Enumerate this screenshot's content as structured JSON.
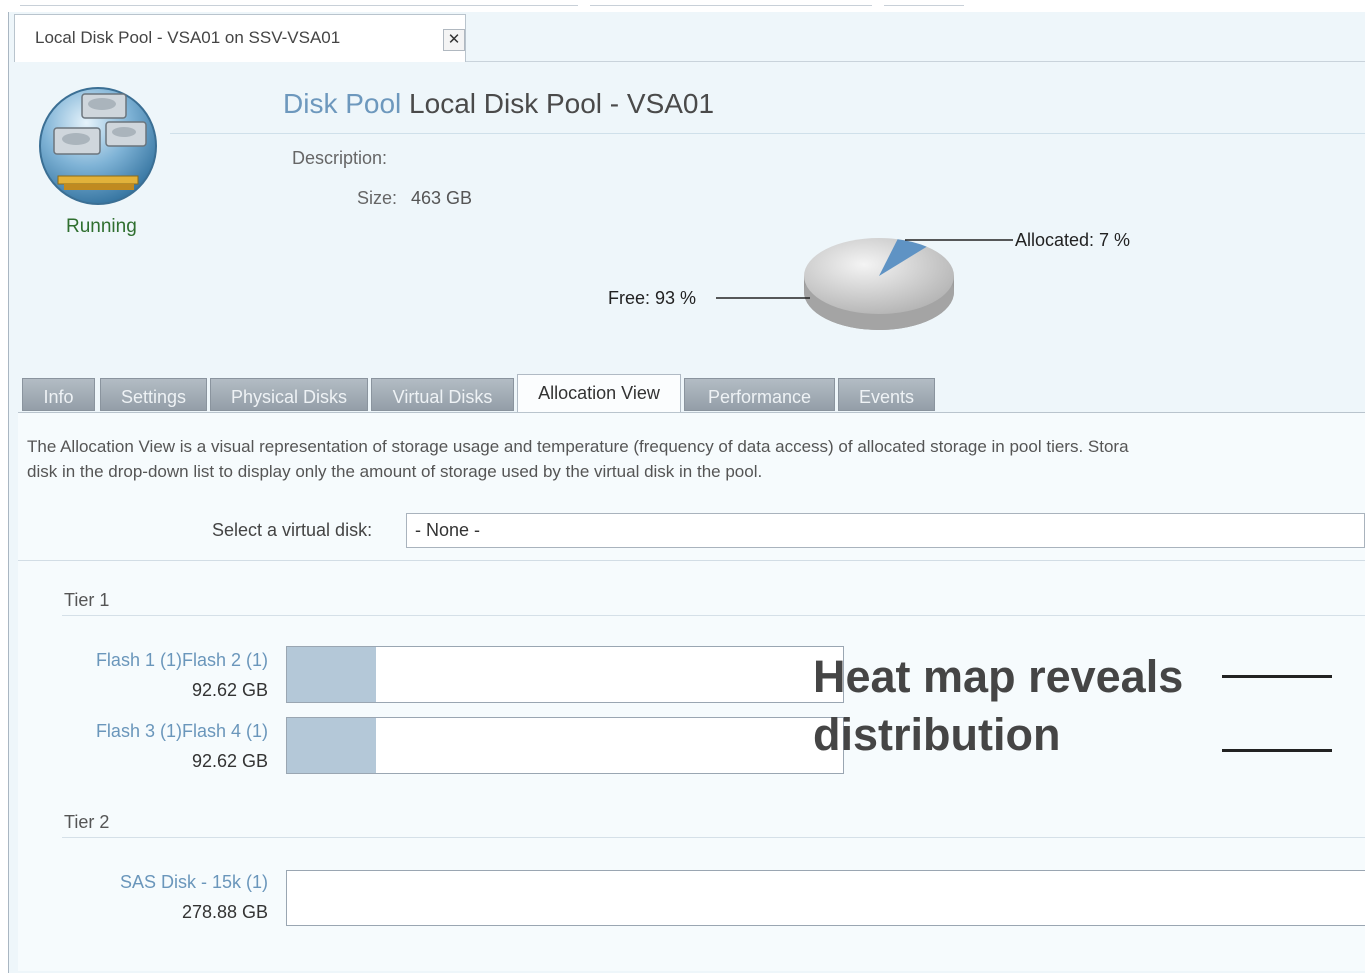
{
  "document_tab": {
    "label": "Local Disk Pool - VSA01 on SSV-VSA01",
    "close_symbol": "✕"
  },
  "pool": {
    "status": "Running",
    "type_label": "Disk Pool",
    "name": "Local Disk Pool - VSA01",
    "description_label": "Description:",
    "size_label": "Size:",
    "size_value": "463 GB"
  },
  "pie_chart": {
    "allocated_label": "Allocated: 7 %",
    "free_label": "Free: 93 %",
    "allocated_percent": 7,
    "free_percent": 93
  },
  "tabs": [
    {
      "label": "Info"
    },
    {
      "label": "Settings"
    },
    {
      "label": "Physical Disks"
    },
    {
      "label": "Virtual Disks"
    },
    {
      "label": "Allocation View"
    },
    {
      "label": "Performance"
    },
    {
      "label": "Events"
    }
  ],
  "active_tab": "Allocation View",
  "allocation_view": {
    "intro_line1": "The Allocation View is a visual representation of storage usage and temperature (frequency of data access) of allocated storage in pool tiers. Stora",
    "intro_line2": "disk in the drop-down list to display only the amount of storage used by the virtual disk in the pool.",
    "select_label": "Select a virtual disk:",
    "select_value": "- None -",
    "tiers": [
      {
        "name": "Tier 1",
        "disks": [
          {
            "name": "Flash 1 (1)Flash 2 (1)",
            "size": "92.62 GB",
            "heat_fraction": 0.16
          },
          {
            "name": "Flash 3 (1)Flash 4 (1)",
            "size": "92.62 GB",
            "heat_fraction": 0.16
          }
        ]
      },
      {
        "name": "Tier 2",
        "disks": [
          {
            "name": "SAS Disk - 15k (1)",
            "size": "278.88 GB",
            "heat_fraction": 0
          }
        ]
      }
    ]
  },
  "annotation": {
    "line1": "Heat map reveals",
    "line2": "distribution"
  },
  "colors": {
    "link_blue": "#6a96bb",
    "running_green": "#2f6f2f",
    "heat_blue": "#b4c8d8",
    "panel_bg": "#eef6fa"
  }
}
